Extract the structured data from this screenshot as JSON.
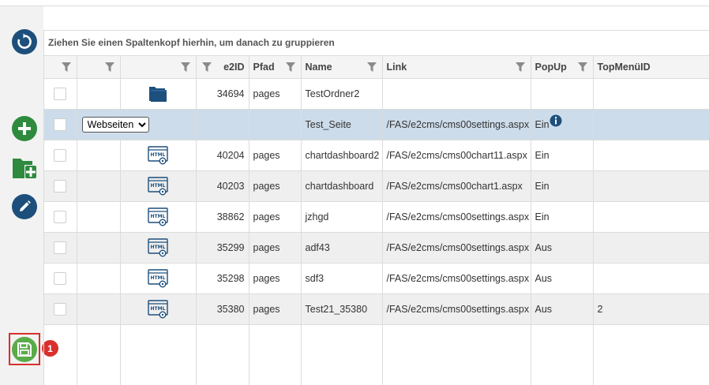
{
  "toolbar": {
    "save_badge": "1"
  },
  "grid": {
    "group_panel_text": "Ziehen Sie einen Spaltenkopf hierhin, um danach zu gruppieren",
    "headers": {
      "e2id": "e2ID",
      "pfad": "Pfad",
      "name": "Name",
      "link": "Link",
      "popup": "PopUp",
      "topmenu": "TopMenüID"
    },
    "editor_select": {
      "selected": "Webseiten"
    },
    "rows": [
      {
        "type": "folder",
        "id": "34694",
        "pfad": "pages",
        "name": "TestOrdner2",
        "link": "",
        "popup": "",
        "topmenu": ""
      },
      {
        "type": "editing",
        "id": "",
        "pfad": "",
        "name": "Test_Seite",
        "link": "/FAS/e2cms/cms00settings.aspx",
        "popup": "Ein",
        "topmenu": ""
      },
      {
        "type": "html",
        "id": "40204",
        "pfad": "pages",
        "name": "chartdashboard2",
        "link": "/FAS/e2cms/cms00chart11.aspx",
        "popup": "Ein",
        "topmenu": ""
      },
      {
        "type": "html",
        "id": "40203",
        "pfad": "pages",
        "name": "chartdashboard",
        "link": "/FAS/e2cms/cms00chart1.aspx",
        "popup": "Ein",
        "topmenu": ""
      },
      {
        "type": "html",
        "id": "38862",
        "pfad": "pages",
        "name": "jzhgd",
        "link": "/FAS/e2cms/cms00settings.aspx",
        "popup": "Ein",
        "topmenu": ""
      },
      {
        "type": "html",
        "id": "35299",
        "pfad": "pages",
        "name": "adf43",
        "link": "/FAS/e2cms/cms00settings.aspx",
        "popup": "Aus",
        "topmenu": ""
      },
      {
        "type": "html",
        "id": "35298",
        "pfad": "pages",
        "name": "sdf3",
        "link": "/FAS/e2cms/cms00settings.aspx",
        "popup": "Aus",
        "topmenu": ""
      },
      {
        "type": "html",
        "id": "35380",
        "pfad": "pages",
        "name": "Test21_35380",
        "link": "/FAS/e2cms/cms00settings.aspx",
        "popup": "Aus",
        "topmenu": "2"
      }
    ]
  },
  "icons": {
    "refresh": "refresh-icon",
    "add": "plus-icon",
    "add_folder": "folder-add-icon",
    "edit": "pencil-icon",
    "save": "save-icon",
    "folder": "folder-icon",
    "html_page": "html-page-icon",
    "info": "info-icon",
    "filter": "filter-icon"
  },
  "colors": {
    "primary": "#1d4f7c",
    "add": "#2e8b3e",
    "save": "#5aab4a",
    "alert": "#d9302c",
    "selected_row": "#cddcea",
    "alt_row": "#efefef"
  }
}
